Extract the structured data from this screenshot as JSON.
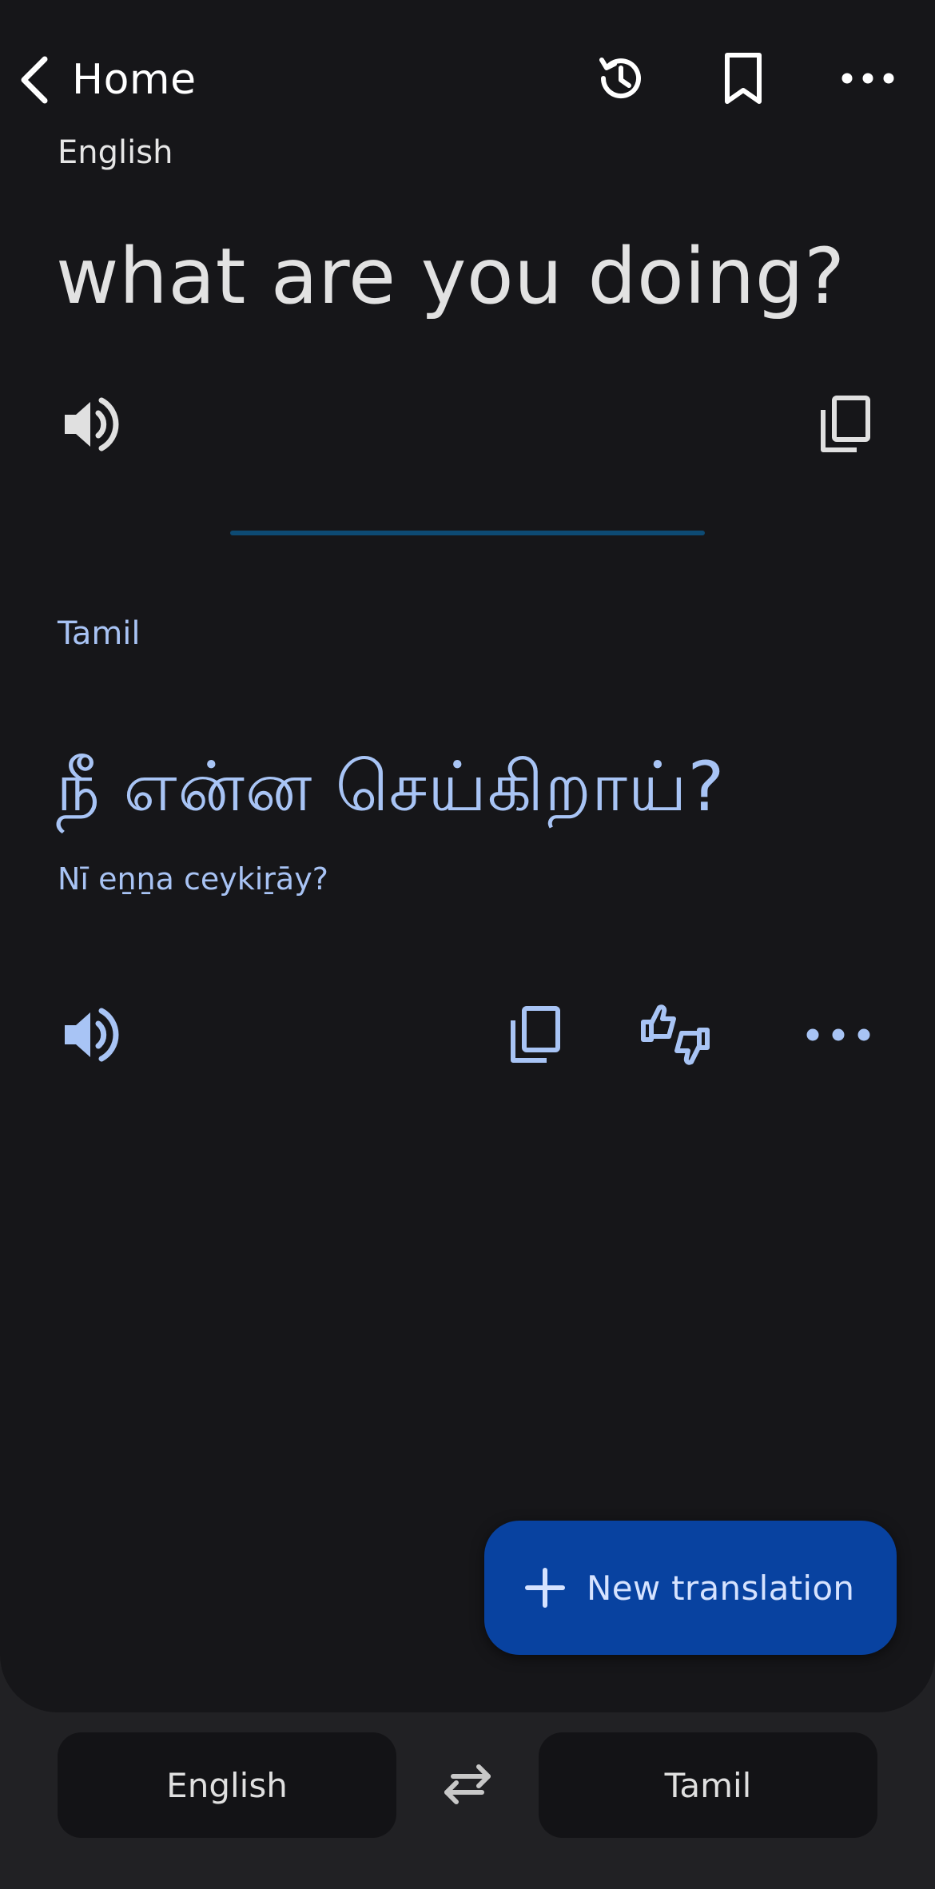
{
  "top_bar": {
    "back_label": "Home"
  },
  "source": {
    "language": "English",
    "text": "what are you doing?"
  },
  "target": {
    "language": "Tamil",
    "text": "நீ என்ன செய்கிறாய்?",
    "transliteration": "Nī eṉṉa ceykiṟāy?"
  },
  "fab": {
    "label": "New translation"
  },
  "language_bar": {
    "source_language": "English",
    "target_language": "Tamil"
  },
  "colors": {
    "background": "#161619",
    "accent_text": "#a8c4f5",
    "fab": "#0842a0",
    "divider": "#0d4a73"
  }
}
